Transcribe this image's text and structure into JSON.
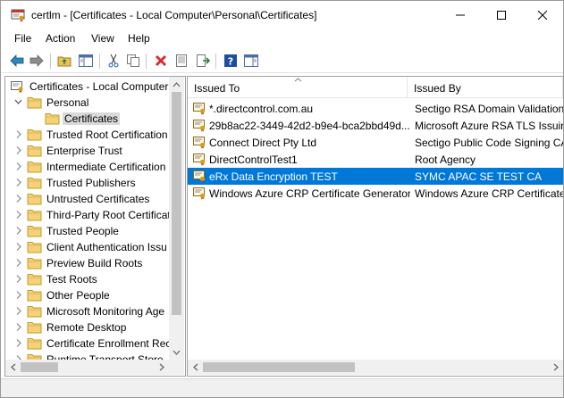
{
  "window": {
    "title": "certlm - [Certificates - Local Computer\\Personal\\Certificates]",
    "accent": "#0078d7"
  },
  "menu": [
    "File",
    "Action",
    "View",
    "Help"
  ],
  "toolbar": {
    "buttons": [
      "back-arrow-icon",
      "forward-arrow-icon",
      "up-folder-icon",
      "show-hide-tree-icon",
      "cut-icon",
      "copy-icon",
      "delete-icon",
      "properties-icon",
      "export-list-icon",
      "help-icon",
      "action-pane-icon"
    ]
  },
  "tree": {
    "items": [
      {
        "label": "Certificates - Local Computer",
        "level": 0,
        "expanded": true
      },
      {
        "label": "Personal",
        "level": 1,
        "expanded": true
      },
      {
        "label": "Certificates",
        "level": 2,
        "selected": true
      },
      {
        "label": "Trusted Root Certification",
        "level": 1
      },
      {
        "label": "Enterprise Trust",
        "level": 1
      },
      {
        "label": "Intermediate Certification",
        "level": 1
      },
      {
        "label": "Trusted Publishers",
        "level": 1
      },
      {
        "label": "Untrusted Certificates",
        "level": 1
      },
      {
        "label": "Third-Party Root Certificat",
        "level": 1
      },
      {
        "label": "Trusted People",
        "level": 1
      },
      {
        "label": "Client Authentication Issu",
        "level": 1
      },
      {
        "label": "Preview Build Roots",
        "level": 1
      },
      {
        "label": "Test Roots",
        "level": 1
      },
      {
        "label": "Other People",
        "level": 1
      },
      {
        "label": "Microsoft Monitoring Age",
        "level": 1
      },
      {
        "label": "Remote Desktop",
        "level": 1
      },
      {
        "label": "Certificate Enrollment Rec",
        "level": 1
      },
      {
        "label": "Runtime Transport Store",
        "level": 1
      }
    ]
  },
  "list": {
    "columns": [
      "Issued To",
      "Issued By"
    ],
    "rows": [
      {
        "issued_to": "*.directcontrol.com.au",
        "issued_by": "Sectigo RSA Domain Validation"
      },
      {
        "issued_to": "29b8ac22-3449-42d2-b9e4-bca2bbd49d...",
        "issued_by": "Microsoft Azure RSA TLS Issuing"
      },
      {
        "issued_to": "Connect Direct Pty Ltd",
        "issued_by": "Sectigo Public Code Signing CA"
      },
      {
        "issued_to": "DirectControlTest1",
        "issued_by": "Root Agency"
      },
      {
        "issued_to": "eRx Data Encryption TEST",
        "issued_by": "SYMC APAC SE TEST CA",
        "selected": true
      },
      {
        "issued_to": "Windows Azure CRP Certificate Generator",
        "issued_by": "Windows Azure CRP Certificate"
      }
    ]
  }
}
